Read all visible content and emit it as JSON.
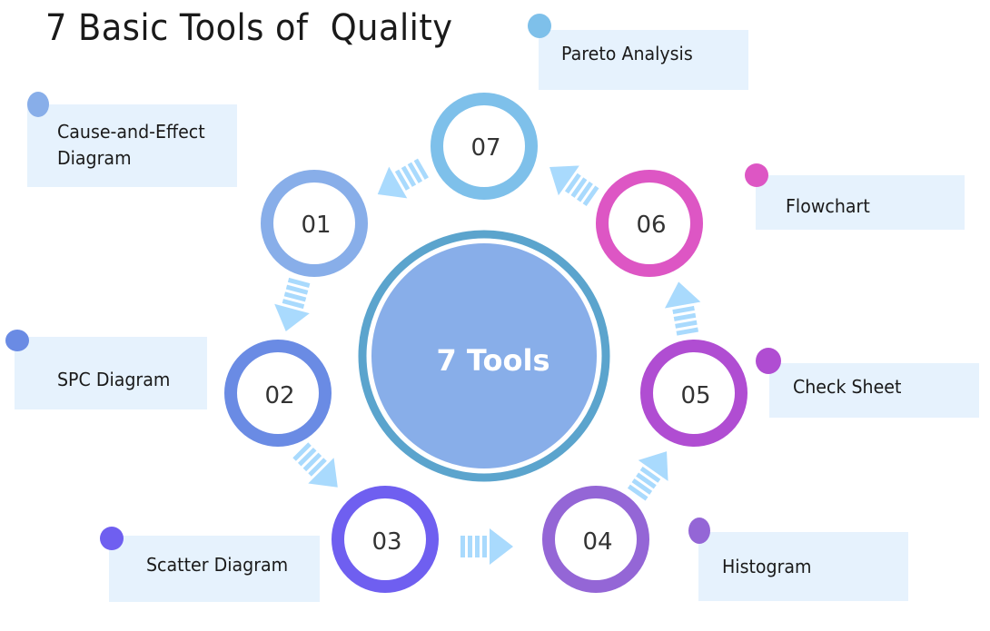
{
  "title": "7 Basic Tools of  Quality",
  "center": {
    "label": "7 Tools",
    "fill": "#88aee9",
    "ring": "#5ba4cd"
  },
  "arrow_color": "#a9dafd",
  "label_bg": "#e6f2fd",
  "steps": [
    {
      "number": "01",
      "label": "Cause-and-Effect\nDiagram",
      "color": "#88aee9"
    },
    {
      "number": "02",
      "label": "SPC Diagram",
      "color": "#6a8be4"
    },
    {
      "number": "03",
      "label": "Scatter Diagram",
      "color": "#6f5ff0"
    },
    {
      "number": "04",
      "label": "Histogram",
      "color": "#9466d6"
    },
    {
      "number": "05",
      "label": "Check Sheet",
      "color": "#b04dd2"
    },
    {
      "number": "06",
      "label": "Flowchart",
      "color": "#dd56c4"
    },
    {
      "number": "07",
      "label": "Pareto Analysis",
      "color": "#7ec0ea"
    }
  ]
}
